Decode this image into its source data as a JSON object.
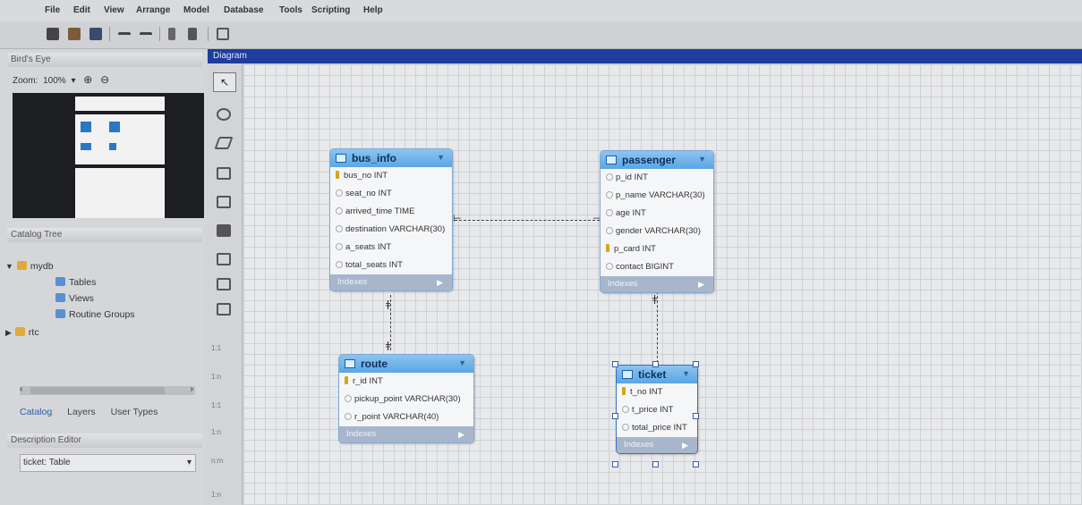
{
  "menu": [
    "File",
    "Edit",
    "View",
    "Arrange",
    "Model",
    "Database",
    "Tools",
    "Scripting",
    "Help"
  ],
  "left_panel": {
    "birds_eye_title": "Bird's Eye",
    "zoom_label": "Zoom:",
    "zoom_value": "100%",
    "catalog_tree_title": "Catalog Tree",
    "tree": {
      "schema": "mydb",
      "children": [
        "Tables",
        "Views",
        "Routine Groups"
      ],
      "other_schema": "rtc"
    },
    "tabs": [
      "Catalog",
      "Layers",
      "User Types"
    ],
    "description_editor_title": "Description Editor",
    "description_select": "ticket: Table"
  },
  "palette_labels": [
    "1:1",
    "1:n",
    "1:1",
    "1:n",
    "n:m",
    "1:n"
  ],
  "diagram": {
    "title": "Diagram",
    "tables": {
      "bus_info": {
        "name": "bus_info",
        "columns": [
          "bus_no INT",
          "seat_no INT",
          "arrived_time TIME",
          "destination VARCHAR(30)",
          "a_seats INT",
          "total_seats INT"
        ],
        "footer": "Indexes"
      },
      "passenger": {
        "name": "passenger",
        "columns": [
          "p_id INT",
          "p_name VARCHAR(30)",
          "age INT",
          "gender VARCHAR(30)",
          "p_card INT",
          "contact BIGINT"
        ],
        "footer": "Indexes"
      },
      "route": {
        "name": "route",
        "columns": [
          "r_id INT",
          "pickup_point VARCHAR(30)",
          "r_point VARCHAR(40)"
        ],
        "footer": "Indexes"
      },
      "ticket": {
        "name": "ticket",
        "columns": [
          "t_no INT",
          "t_price INT",
          "total_price INT"
        ],
        "footer": "Indexes"
      }
    }
  },
  "colors": {
    "diagram_title_bar": "#1e3d9c",
    "table_header": "#5aa6e4",
    "primary_key": "#d6a520"
  }
}
